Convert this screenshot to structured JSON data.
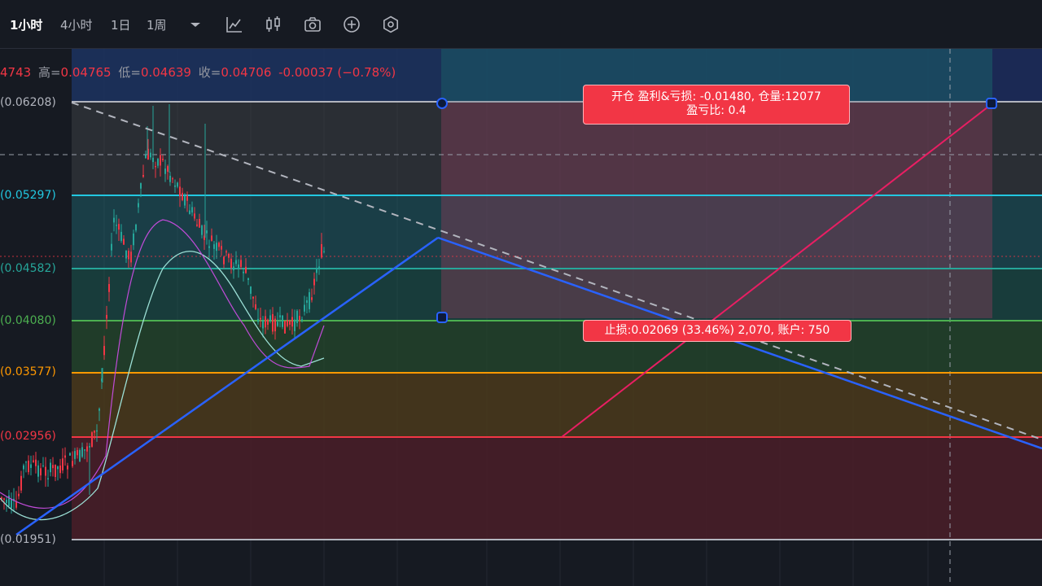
{
  "toolbar": {
    "intervals": [
      "1小时",
      "4小时",
      "1日",
      "1周"
    ],
    "active_interval": "1小时",
    "icons": [
      "chevron-down-icon",
      "indicators-icon",
      "candle-style-icon",
      "camera-icon",
      "add-icon",
      "settings-icon"
    ]
  },
  "ohlc": {
    "open_value": "4743",
    "high_label": "高=",
    "high_value": "0.04765",
    "low_label": "低=",
    "low_value": "0.04639",
    "close_label": "收=",
    "close_value": "0.04706",
    "change": "-0.00037 (−0.78%)"
  },
  "fib_levels": [
    {
      "label": "(0.06208)",
      "color": "#b2b5be"
    },
    {
      "label": "(0.05297)",
      "color": "#22c7e0"
    },
    {
      "label": "(0.04582)",
      "color": "#26a69a"
    },
    {
      "label": "(0.04080)",
      "color": "#4caf50"
    },
    {
      "label": "(0.03577)",
      "color": "#ff9800"
    },
    {
      "label": "(0.02956)",
      "color": "#f23645"
    },
    {
      "label": "(0.01951)",
      "color": "#b2b5be"
    }
  ],
  "position_tool": {
    "entry_label": "开仓 盈利&亏损: -0.01480, 仓量:12077",
    "ratio_label": "盈亏比: 0.4",
    "stop_label": "止损:0.02069 (33.46%) 2,070, 账户: 750"
  },
  "colors": {
    "background": "#161a22",
    "up": "#26a69a",
    "down": "#f23645",
    "trend_line": "#2962ff",
    "long_line": "#e91e63"
  }
}
